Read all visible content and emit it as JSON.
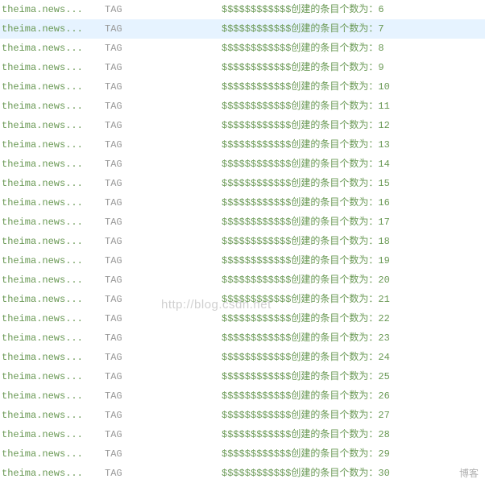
{
  "log": {
    "source": "theima.news...",
    "tag": "TAG",
    "msg_prefix": "$$$$$$$$$$$$创建的条目个数为：",
    "entries": [
      {
        "count": "6",
        "highlighted": false
      },
      {
        "count": "7",
        "highlighted": true
      },
      {
        "count": "8",
        "highlighted": false
      },
      {
        "count": "9",
        "highlighted": false
      },
      {
        "count": "10",
        "highlighted": false
      },
      {
        "count": "11",
        "highlighted": false
      },
      {
        "count": "12",
        "highlighted": false
      },
      {
        "count": "13",
        "highlighted": false
      },
      {
        "count": "14",
        "highlighted": false
      },
      {
        "count": "15",
        "highlighted": false
      },
      {
        "count": "16",
        "highlighted": false
      },
      {
        "count": "17",
        "highlighted": false
      },
      {
        "count": "18",
        "highlighted": false
      },
      {
        "count": "19",
        "highlighted": false
      },
      {
        "count": "20",
        "highlighted": false
      },
      {
        "count": "21",
        "highlighted": false
      },
      {
        "count": "22",
        "highlighted": false
      },
      {
        "count": "23",
        "highlighted": false
      },
      {
        "count": "24",
        "highlighted": false
      },
      {
        "count": "25",
        "highlighted": false
      },
      {
        "count": "26",
        "highlighted": false
      },
      {
        "count": "27",
        "highlighted": false
      },
      {
        "count": "28",
        "highlighted": false
      },
      {
        "count": "29",
        "highlighted": false
      },
      {
        "count": "30",
        "highlighted": false
      }
    ]
  },
  "watermark": "http://blog.csdn.net",
  "footer_mark": "博客"
}
